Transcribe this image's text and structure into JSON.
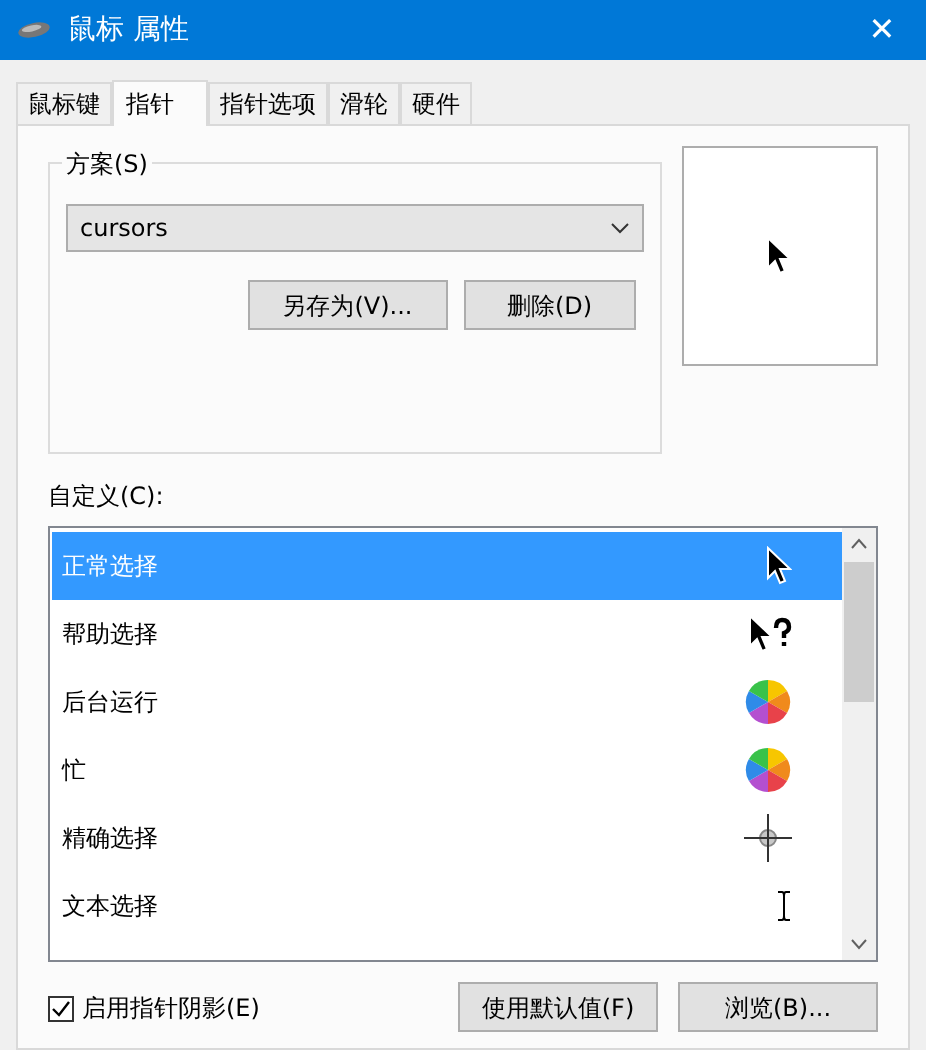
{
  "window": {
    "title": "鼠标 属性",
    "close": "✕"
  },
  "tabs": [
    {
      "label": "鼠标键",
      "selected": false
    },
    {
      "label": "指针",
      "selected": true
    },
    {
      "label": "指针选项",
      "selected": false
    },
    {
      "label": "滑轮",
      "selected": false
    },
    {
      "label": "硬件",
      "selected": false
    }
  ],
  "scheme": {
    "label": "方案(S)",
    "value": "cursors",
    "buttons": [
      "另存为(V)...",
      "删除(D)"
    ]
  },
  "customize": {
    "label": "自定义(C):",
    "items": [
      {
        "label": "正常选择",
        "kind": "arrow",
        "selected": true
      },
      {
        "label": "帮助选择",
        "kind": "help",
        "selected": false
      },
      {
        "label": "后台运行",
        "kind": "busy",
        "selected": false
      },
      {
        "label": "忙",
        "kind": "busy",
        "selected": false
      },
      {
        "label": "精确选择",
        "kind": "crosshair",
        "selected": false
      },
      {
        "label": "文本选择",
        "kind": "text",
        "selected": false
      }
    ]
  },
  "shadow": {
    "label": "启用指针阴影(E)",
    "checked": true
  },
  "buttons": [
    "使用默认值(F)",
    "浏览(B)..."
  ]
}
